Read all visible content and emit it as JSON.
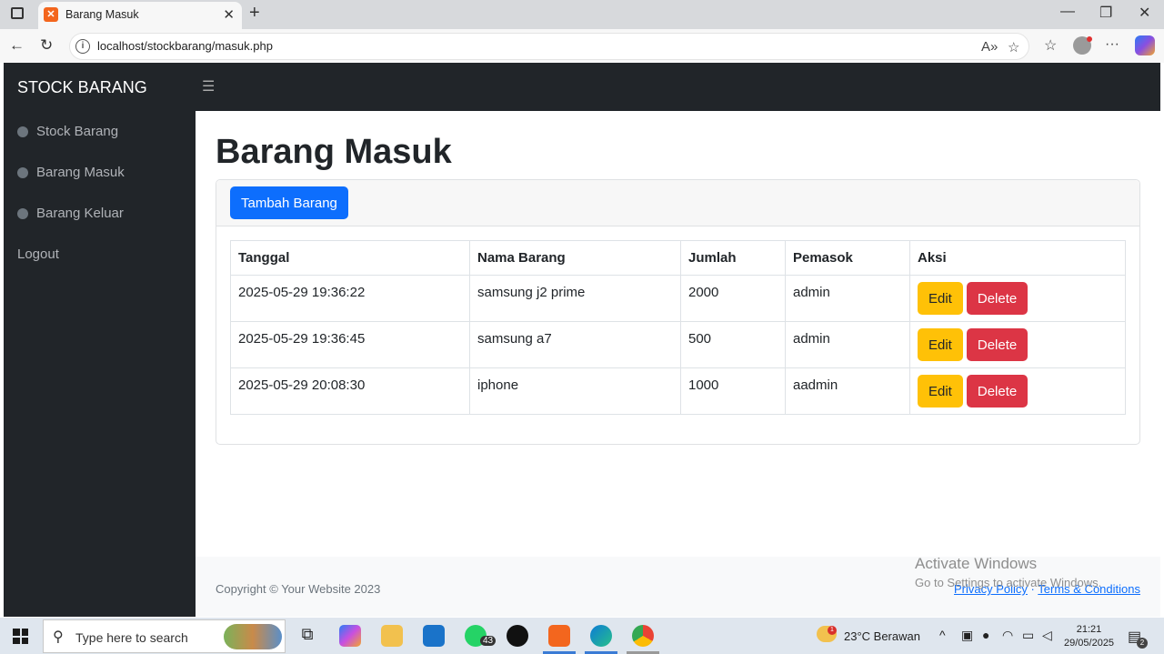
{
  "browser": {
    "tab_title": "Barang Masuk",
    "favicon": "xampp-icon",
    "url": "localhost/stockbarang/masuk.php"
  },
  "app": {
    "brand": "STOCK BARANG",
    "sidebar": {
      "items": [
        {
          "label": "Stock Barang",
          "icon": "tachometer-icon"
        },
        {
          "label": "Barang Masuk",
          "icon": "tachometer-icon"
        },
        {
          "label": "Barang Keluar",
          "icon": "tachometer-icon"
        },
        {
          "label": "Logout"
        }
      ]
    },
    "page_title": "Barang Masuk",
    "add_button": "Tambah Barang",
    "table": {
      "headers": [
        "Tanggal",
        "Nama Barang",
        "Jumlah",
        "Pemasok",
        "Aksi"
      ],
      "rows": [
        {
          "tanggal": "2025-05-29 19:36:22",
          "nama": "samsung j2 prime",
          "jumlah": "2000",
          "pemasok": "admin"
        },
        {
          "tanggal": "2025-05-29 19:36:45",
          "nama": "samsung a7",
          "jumlah": "500",
          "pemasok": "admin"
        },
        {
          "tanggal": "2025-05-29 20:08:30",
          "nama": "iphone",
          "jumlah": "1000",
          "pemasok": "aadmin"
        }
      ],
      "edit_label": "Edit",
      "delete_label": "Delete"
    },
    "footer": {
      "copyright": "Copyright © Your Website 2023",
      "privacy": "Privacy Policy",
      "separator": "·",
      "terms": "Terms & Conditions"
    },
    "colors": {
      "primary": "#0d6efd",
      "warning": "#ffc107",
      "danger": "#dc3545",
      "dark": "#212529"
    }
  },
  "watermark": {
    "line1": "Activate Windows",
    "line2": "Go to Settings to activate Windows."
  },
  "taskbar": {
    "search_placeholder": "Type here to search",
    "whatsapp_badge": "43",
    "weather": "23°C  Berawan",
    "weather_alert": "1",
    "time": "21:21",
    "date": "29/05/2025",
    "notifications": "2"
  }
}
